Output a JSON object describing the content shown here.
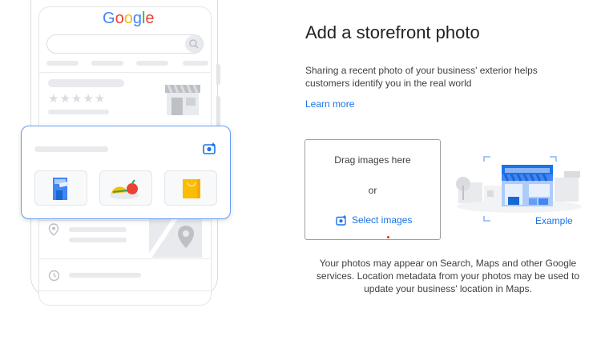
{
  "illustration": {
    "logo_text": "Google",
    "logo_colors": [
      "#4285f4",
      "#ea4335",
      "#fbbc04",
      "#4285f4",
      "#34a853",
      "#ea4335"
    ],
    "stars": "★★★★★"
  },
  "panel": {
    "title": "Add a storefront photo",
    "description": "Sharing a recent photo of your business' exterior helps customers identify you in the real world",
    "learn_more": "Learn more"
  },
  "dropzone": {
    "drag_text": "Drag images here",
    "or_text": "or",
    "select_label": "Select images"
  },
  "example": {
    "label": "Example"
  },
  "notice": "Your photos may appear on Search, Maps and other Google services. Location metadata from your photos may be used to update your business' location in Maps.",
  "colors": {
    "accent": "#1a73e8",
    "card_border": "#669df6",
    "placeholder": "#e8eaed"
  }
}
